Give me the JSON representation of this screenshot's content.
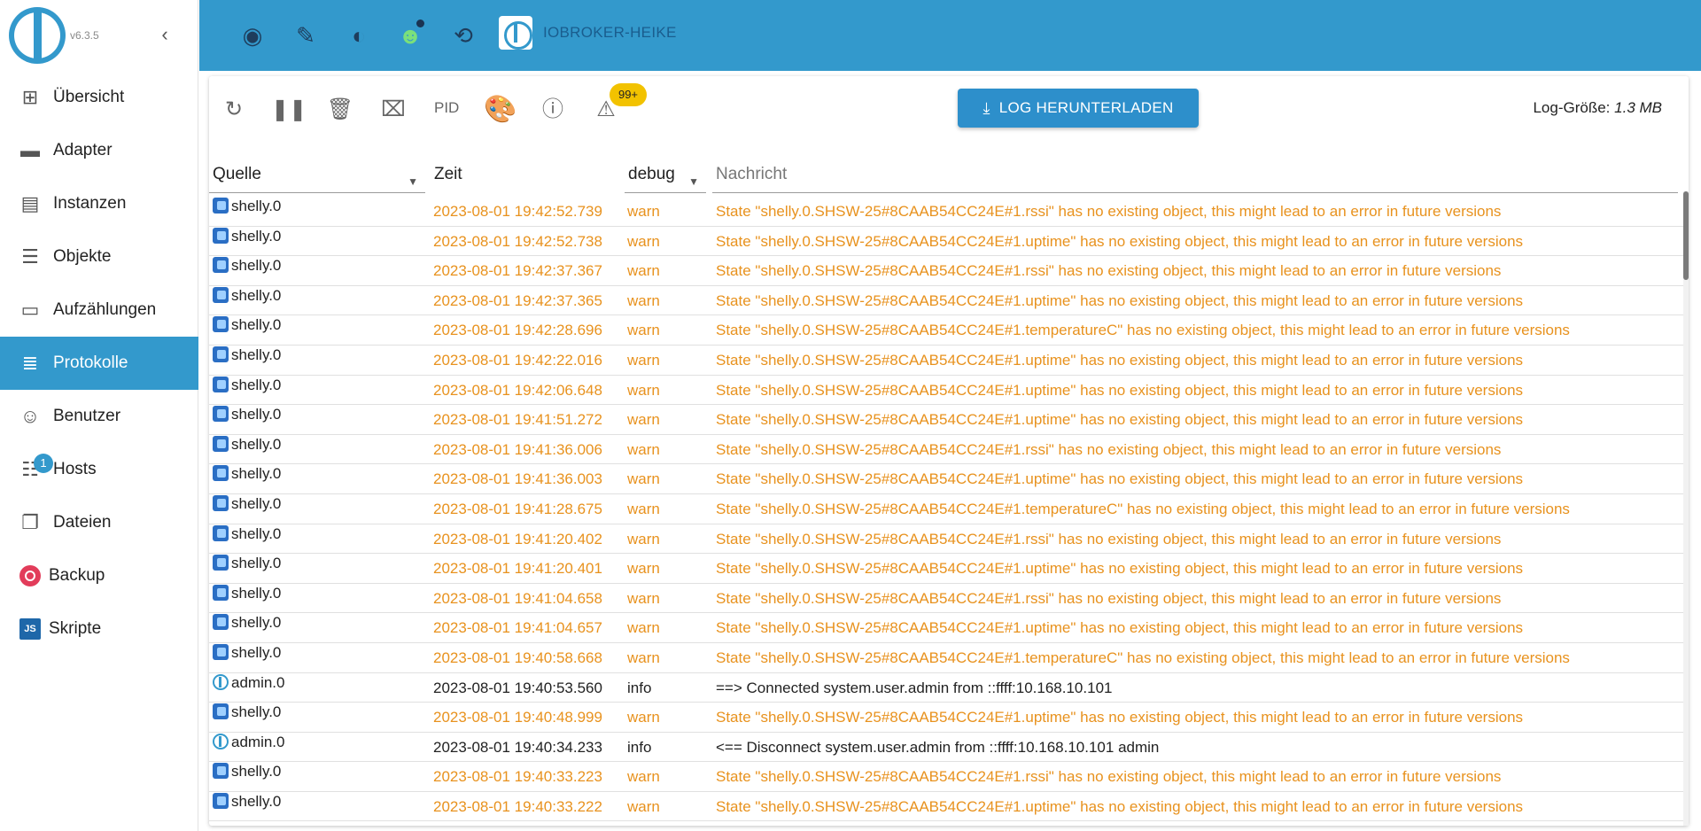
{
  "sidebar": {
    "version": "v6.3.5",
    "items": [
      {
        "label": "Übersicht",
        "icon": "grid-icon"
      },
      {
        "label": "Adapter",
        "icon": "store-icon"
      },
      {
        "label": "Instanzen",
        "icon": "instances-icon"
      },
      {
        "label": "Objekte",
        "icon": "list-icon"
      },
      {
        "label": "Aufzählungen",
        "icon": "enum-icon"
      },
      {
        "label": "Protokolle",
        "icon": "log-icon"
      },
      {
        "label": "Benutzer",
        "icon": "user-icon"
      },
      {
        "label": "Hosts",
        "icon": "hosts-icon",
        "badge": "1"
      },
      {
        "label": "Dateien",
        "icon": "files-icon"
      },
      {
        "label": "Backup",
        "icon": "backup-icon"
      },
      {
        "label": "Skripte",
        "icon": "js-icon",
        "icon_text": "JS"
      }
    ]
  },
  "header": {
    "host_name": "IOBROKER-HEIKE"
  },
  "toolbar": {
    "pid_label": "PID",
    "warn_count": "99+",
    "download_label": "LOG HERUNTERLADEN",
    "log_size_label": "Log-Größe:",
    "log_size_value": "1.3 MB"
  },
  "table": {
    "columns": {
      "source": "Quelle",
      "time": "Zeit",
      "severity": "debug",
      "message": "Nachricht"
    },
    "rows": [
      {
        "source": "shelly.0",
        "time": "2023-08-01 19:42:52.739",
        "severity": "warn",
        "message": "State \"shelly.0.SHSW-25#8CAAB54CC24E#1.rssi\" has no existing object, this might lead to an error in future versions"
      },
      {
        "source": "shelly.0",
        "time": "2023-08-01 19:42:52.738",
        "severity": "warn",
        "message": "State \"shelly.0.SHSW-25#8CAAB54CC24E#1.uptime\" has no existing object, this might lead to an error in future versions"
      },
      {
        "source": "shelly.0",
        "time": "2023-08-01 19:42:37.367",
        "severity": "warn",
        "message": "State \"shelly.0.SHSW-25#8CAAB54CC24E#1.rssi\" has no existing object, this might lead to an error in future versions"
      },
      {
        "source": "shelly.0",
        "time": "2023-08-01 19:42:37.365",
        "severity": "warn",
        "message": "State \"shelly.0.SHSW-25#8CAAB54CC24E#1.uptime\" has no existing object, this might lead to an error in future versions"
      },
      {
        "source": "shelly.0",
        "time": "2023-08-01 19:42:28.696",
        "severity": "warn",
        "message": "State \"shelly.0.SHSW-25#8CAAB54CC24E#1.temperatureC\" has no existing object, this might lead to an error in future versions"
      },
      {
        "source": "shelly.0",
        "time": "2023-08-01 19:42:22.016",
        "severity": "warn",
        "message": "State \"shelly.0.SHSW-25#8CAAB54CC24E#1.uptime\" has no existing object, this might lead to an error in future versions"
      },
      {
        "source": "shelly.0",
        "time": "2023-08-01 19:42:06.648",
        "severity": "warn",
        "message": "State \"shelly.0.SHSW-25#8CAAB54CC24E#1.uptime\" has no existing object, this might lead to an error in future versions"
      },
      {
        "source": "shelly.0",
        "time": "2023-08-01 19:41:51.272",
        "severity": "warn",
        "message": "State \"shelly.0.SHSW-25#8CAAB54CC24E#1.uptime\" has no existing object, this might lead to an error in future versions"
      },
      {
        "source": "shelly.0",
        "time": "2023-08-01 19:41:36.006",
        "severity": "warn",
        "message": "State \"shelly.0.SHSW-25#8CAAB54CC24E#1.rssi\" has no existing object, this might lead to an error in future versions"
      },
      {
        "source": "shelly.0",
        "time": "2023-08-01 19:41:36.003",
        "severity": "warn",
        "message": "State \"shelly.0.SHSW-25#8CAAB54CC24E#1.uptime\" has no existing object, this might lead to an error in future versions"
      },
      {
        "source": "shelly.0",
        "time": "2023-08-01 19:41:28.675",
        "severity": "warn",
        "message": "State \"shelly.0.SHSW-25#8CAAB54CC24E#1.temperatureC\" has no existing object, this might lead to an error in future versions"
      },
      {
        "source": "shelly.0",
        "time": "2023-08-01 19:41:20.402",
        "severity": "warn",
        "message": "State \"shelly.0.SHSW-25#8CAAB54CC24E#1.rssi\" has no existing object, this might lead to an error in future versions"
      },
      {
        "source": "shelly.0",
        "time": "2023-08-01 19:41:20.401",
        "severity": "warn",
        "message": "State \"shelly.0.SHSW-25#8CAAB54CC24E#1.uptime\" has no existing object, this might lead to an error in future versions"
      },
      {
        "source": "shelly.0",
        "time": "2023-08-01 19:41:04.658",
        "severity": "warn",
        "message": "State \"shelly.0.SHSW-25#8CAAB54CC24E#1.rssi\" has no existing object, this might lead to an error in future versions"
      },
      {
        "source": "shelly.0",
        "time": "2023-08-01 19:41:04.657",
        "severity": "warn",
        "message": "State \"shelly.0.SHSW-25#8CAAB54CC24E#1.uptime\" has no existing object, this might lead to an error in future versions"
      },
      {
        "source": "shelly.0",
        "time": "2023-08-01 19:40:58.668",
        "severity": "warn",
        "message": "State \"shelly.0.SHSW-25#8CAAB54CC24E#1.temperatureC\" has no existing object, this might lead to an error in future versions"
      },
      {
        "source": "admin.0",
        "time": "2023-08-01 19:40:53.560",
        "severity": "info",
        "message": "==> Connected system.user.admin from ::ffff:10.168.10.101"
      },
      {
        "source": "shelly.0",
        "time": "2023-08-01 19:40:48.999",
        "severity": "warn",
        "message": "State \"shelly.0.SHSW-25#8CAAB54CC24E#1.uptime\" has no existing object, this might lead to an error in future versions"
      },
      {
        "source": "admin.0",
        "time": "2023-08-01 19:40:34.233",
        "severity": "info",
        "message": "<== Disconnect system.user.admin from ::ffff:10.168.10.101 admin"
      },
      {
        "source": "shelly.0",
        "time": "2023-08-01 19:40:33.223",
        "severity": "warn",
        "message": "State \"shelly.0.SHSW-25#8CAAB54CC24E#1.rssi\" has no existing object, this might lead to an error in future versions"
      },
      {
        "source": "shelly.0",
        "time": "2023-08-01 19:40:33.222",
        "severity": "warn",
        "message": "State \"shelly.0.SHSW-25#8CAAB54CC24E#1.uptime\" has no existing object, this might lead to an error in future versions"
      }
    ]
  },
  "colors": {
    "accent": "#3399cc",
    "warn": "#e8921e",
    "badge": "#f2c200"
  }
}
